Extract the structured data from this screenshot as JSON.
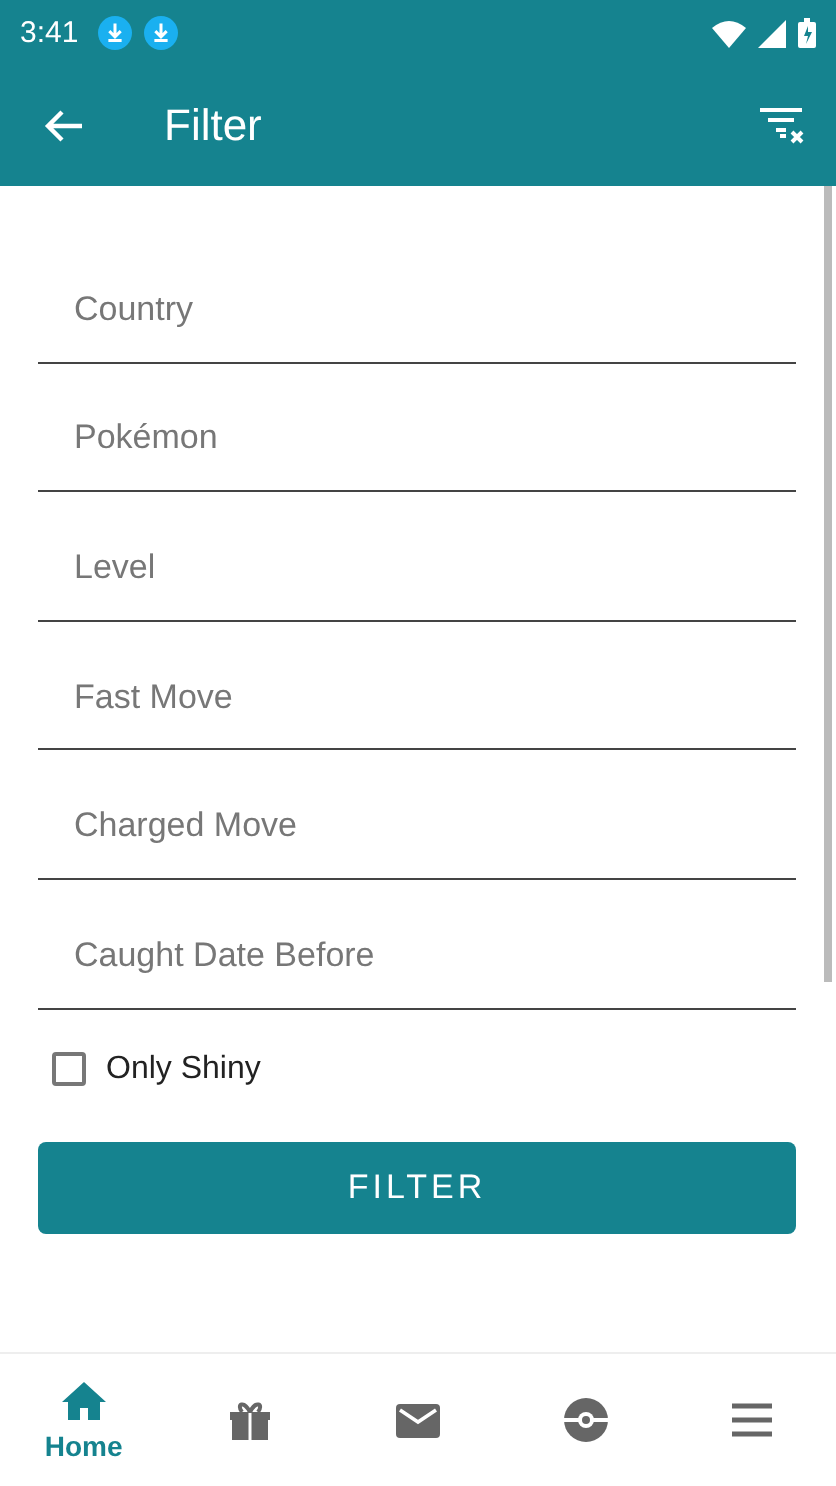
{
  "status_bar": {
    "time": "3:41",
    "notifications": [
      {
        "kind": "download"
      },
      {
        "kind": "download"
      }
    ]
  },
  "app_bar": {
    "title": "Filter"
  },
  "fields": [
    {
      "placeholder": "Country"
    },
    {
      "placeholder": "Pokémon"
    },
    {
      "placeholder": "Level"
    },
    {
      "placeholder": "Fast Move"
    },
    {
      "placeholder": "Charged Move"
    },
    {
      "placeholder": "Caught Date Before"
    }
  ],
  "only_shiny": {
    "label": "Only Shiny",
    "checked": false
  },
  "filter_button": {
    "label": "FILTER"
  },
  "bottom_nav": [
    {
      "kind": "home",
      "label": "Home",
      "selected": true
    },
    {
      "kind": "gift",
      "selected": false
    },
    {
      "kind": "mail",
      "selected": false
    },
    {
      "kind": "ball",
      "selected": false
    },
    {
      "kind": "menu",
      "selected": false
    }
  ]
}
